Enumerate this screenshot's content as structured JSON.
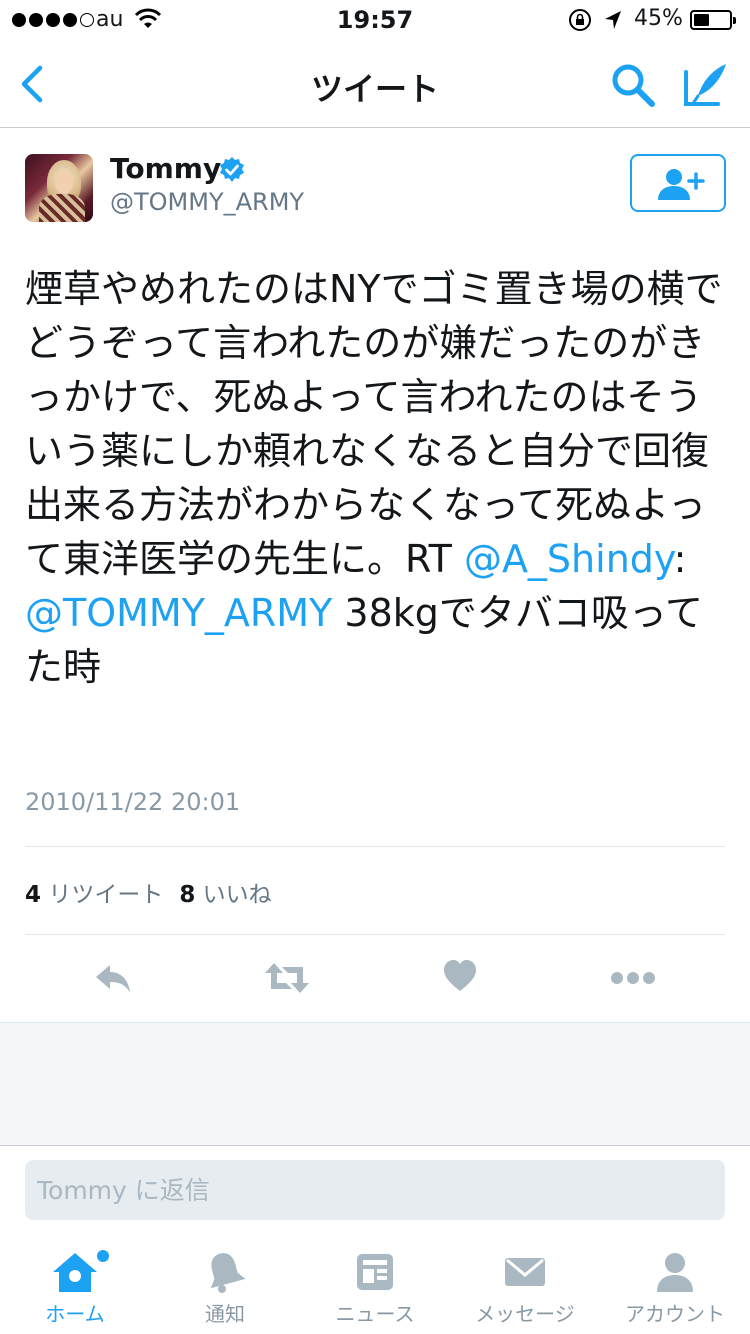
{
  "status_bar": {
    "carrier": "au",
    "time": "19:57",
    "battery_percent": "45%",
    "battery_level": 0.45
  },
  "nav": {
    "title": "ツイート"
  },
  "tweet": {
    "name": "Tommy",
    "handle": "@TOMMY_ARMY",
    "text_main": "煙草やめれたのはNYでゴミ置き場の横でどうぞって言われたのが嫌だったのがきっかけで、死ぬよって言われたのはそういう薬にしか頼れなくなると自分で回復出来る方法がわからなくなって死ぬよって東洋医学の先生に。RT ",
    "mention_1": "@A_Shindy",
    "colon": ":",
    "mention_2": "@TOMMY_ARMY",
    "text_tail": " 38kgでタバコ吸ってた時",
    "timestamp": "2010/11/22 20:01",
    "retweet_count": "4",
    "retweet_label": "リツイート",
    "like_count": "8",
    "like_label": "いいね"
  },
  "reply": {
    "placeholder": "Tommy に返信"
  },
  "tabs": [
    {
      "label": "ホーム",
      "icon": "home-icon",
      "active": true
    },
    {
      "label": "通知",
      "icon": "bell-icon"
    },
    {
      "label": "ニュース",
      "icon": "news-icon"
    },
    {
      "label": "メッセージ",
      "icon": "envelope-icon"
    },
    {
      "label": "アカウント",
      "icon": "person-icon"
    }
  ],
  "colors": {
    "accent": "#1da1f2",
    "text": "#14171a",
    "muted": "#657786",
    "icon_grey": "#aab8c2"
  }
}
